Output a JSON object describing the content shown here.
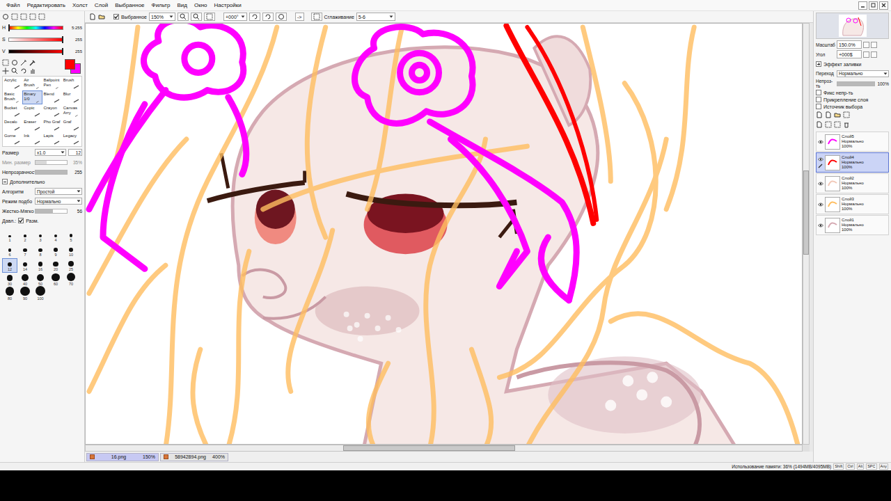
{
  "menu": [
    "Файл",
    "Редактировать",
    "Холст",
    "Слой",
    "Выбранное",
    "Фильтр",
    "Вид",
    "Окно",
    "Настройки"
  ],
  "toolbar": {
    "selection": {
      "label": "Выбранное",
      "checked": true
    },
    "zoom": "150%",
    "angle": "+000°",
    "flip": "->",
    "smoothing_label": "Сглаживание",
    "smoothing": "5-6"
  },
  "color": {
    "sliders": [
      {
        "name": "H",
        "kind": "hue",
        "reading": "5:255",
        "level": 0.0
      },
      {
        "name": "S",
        "kind": "saturation",
        "reading": "255",
        "level": 1
      },
      {
        "name": "V",
        "kind": "value",
        "reading": "255",
        "level": 1
      }
    ],
    "primary": "#ff0000",
    "secondary": "#ff00ff"
  },
  "tools": [
    {
      "label": "Acrylic",
      "selected": false
    },
    {
      "label": "Air Brush",
      "selected": false
    },
    {
      "label": "Ballpoint Pen",
      "selected": false
    },
    {
      "label": "Brush",
      "selected": false
    },
    {
      "label": "Basic Brush",
      "selected": false
    },
    {
      "label": "Binary 1/0",
      "selected": true
    },
    {
      "label": "Blend",
      "selected": false
    },
    {
      "label": "Blur",
      "selected": false
    },
    {
      "label": "Bucket",
      "selected": false
    },
    {
      "label": "Copic",
      "selected": false
    },
    {
      "label": "Crayon",
      "selected": false
    },
    {
      "label": "Canvas Arry",
      "selected": false
    },
    {
      "label": "Decalo",
      "selected": false
    },
    {
      "label": "Eraser",
      "selected": false
    },
    {
      "label": "Pho Graf",
      "selected": false
    },
    {
      "label": "Graf",
      "selected": false
    },
    {
      "label": "Gorne",
      "selected": false
    },
    {
      "label": "Ink",
      "selected": false
    },
    {
      "label": "Lapis",
      "selected": false
    },
    {
      "label": "Legacy",
      "selected": false
    }
  ],
  "brush_settings": {
    "size_label": "Размер",
    "size_scale": "x1.0",
    "size": "12",
    "min_size_label": "Мин. размер",
    "min_size": "35%",
    "min_size_level": 0.35,
    "min_size_disabled": true,
    "density_label": "Непрозрачност",
    "density": "255",
    "density_level": 1,
    "advanced_label": "Дополнительно",
    "advanced_expanded": true,
    "algorithm_label": "Алгоритм",
    "algorithm": "Простой",
    "blend_label": "Режим подбо",
    "blend": "Нормально",
    "hardness_label": "Жестко-Мягко",
    "hardness": "56",
    "hardness_level": 0.56,
    "pressure_label": "Давл.:",
    "pressure_size": {
      "label": "Разм.",
      "checked": true
    }
  },
  "brush_sizes": [
    {
      "label": "1",
      "selected": false
    },
    {
      "label": "2",
      "selected": false
    },
    {
      "label": "3",
      "selected": false
    },
    {
      "label": "4",
      "selected": false
    },
    {
      "label": "5",
      "selected": false
    },
    {
      "label": "6",
      "selected": false
    },
    {
      "label": "7",
      "selected": false
    },
    {
      "label": "8",
      "selected": false
    },
    {
      "label": "9",
      "selected": false
    },
    {
      "label": "10",
      "selected": false
    },
    {
      "label": "12",
      "selected": true
    },
    {
      "label": "14",
      "selected": false
    },
    {
      "label": "16",
      "selected": false
    },
    {
      "label": "20",
      "selected": false
    },
    {
      "label": "25",
      "selected": false
    },
    {
      "label": "30",
      "selected": false
    },
    {
      "label": "40",
      "selected": false
    },
    {
      "label": "50",
      "selected": false
    },
    {
      "label": "60",
      "selected": false
    },
    {
      "label": "70",
      "selected": false
    },
    {
      "label": "80",
      "selected": false
    },
    {
      "label": "90",
      "selected": false
    },
    {
      "label": "100",
      "selected": false
    }
  ],
  "scroll": {
    "h_start": 0.36,
    "h_size": 0.24,
    "v_start": 0.35,
    "v_size": 0.2
  },
  "document_tabs": [
    {
      "name": "16.png",
      "zoom": "150%",
      "selected": true
    },
    {
      "name": "58942894.png",
      "zoom": "400%",
      "selected": false
    }
  ],
  "navigator": {
    "zoom_label": "Масштаб",
    "zoom": "150.0%",
    "angle_label": "Угол",
    "angle": "+000$"
  },
  "layer_panel": {
    "section": "Эффект заливки",
    "section_expanded": false,
    "blend_label": "Переход",
    "blend": "Нормально",
    "opacity_label": "Непроз-ть",
    "opacity": "100%",
    "opacity_level": 1,
    "checkboxes": [
      {
        "label": "Фикс непр-ть",
        "checked": false
      },
      {
        "label": "Прикрепление слоя",
        "checked": false
      },
      {
        "label": "Источник выбора",
        "checked": false
      }
    ]
  },
  "layers": [
    {
      "name": "Слой5",
      "mode": "Нормально",
      "opacity": "100%",
      "visible": true,
      "selected": false,
      "color": "#ff00ff"
    },
    {
      "name": "Слой4",
      "mode": "Нормально",
      "opacity": "100%",
      "visible": true,
      "selected": true,
      "color": "#ff0000"
    },
    {
      "name": "Слой2",
      "mode": "Нормально",
      "opacity": "100%",
      "visible": true,
      "selected": false,
      "color": "#f2c9b8"
    },
    {
      "name": "Слой3",
      "mode": "Нормально",
      "opacity": "100%",
      "visible": true,
      "selected": false,
      "color": "#ffbe60"
    },
    {
      "name": "Слой1",
      "mode": "Нормально",
      "opacity": "100%",
      "visible": true,
      "selected": false,
      "color": "#d5a9b2"
    }
  ],
  "status_bar": {
    "memory": "Использование памяти: 36% (1494МВ/4095МВ)",
    "keys": [
      "Shift",
      "Ctrl",
      "Alt",
      "SPC",
      "Any"
    ]
  }
}
